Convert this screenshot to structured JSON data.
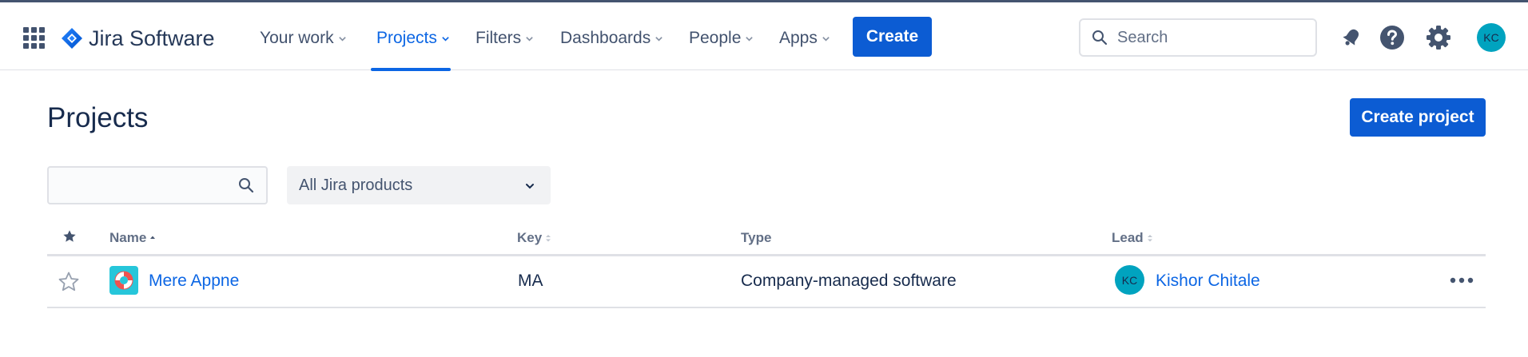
{
  "app": {
    "name": "Jira Software"
  },
  "topnav": {
    "items": [
      {
        "label": "Your work",
        "active": false
      },
      {
        "label": "Projects",
        "active": true
      },
      {
        "label": "Filters",
        "active": false
      },
      {
        "label": "Dashboards",
        "active": false
      },
      {
        "label": "People",
        "active": false
      },
      {
        "label": "Apps",
        "active": false
      }
    ],
    "create_label": "Create",
    "search_placeholder": "Search",
    "icons": [
      "notifications-icon",
      "help-icon",
      "settings-icon"
    ],
    "user_initials": "KC"
  },
  "page": {
    "title": "Projects",
    "create_project_label": "Create project"
  },
  "filters": {
    "search_value": "",
    "product_selected": "All Jira products"
  },
  "table": {
    "columns": [
      "Name",
      "Key",
      "Type",
      "Lead"
    ],
    "rows": [
      {
        "starred": false,
        "name": "Mere Appne",
        "key": "MA",
        "type": "Company-managed software",
        "lead_initials": "KC",
        "lead_name": "Kishor Chitale"
      }
    ]
  },
  "colors": {
    "brand_blue": "#0c5cd3",
    "link_blue": "#0c66e4",
    "avatar_teal": "#00a3bf",
    "project_icon_bg": "#26c6da"
  }
}
